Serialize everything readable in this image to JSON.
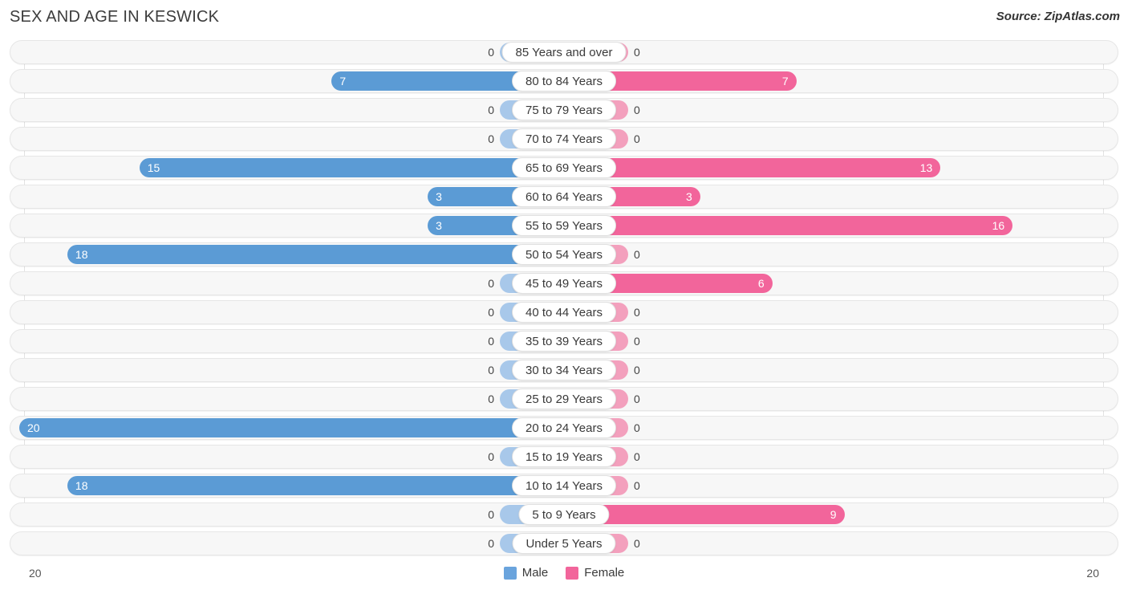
{
  "header": {
    "title": "SEX AND AGE IN KESWICK",
    "source": "Source: ZipAtlas.com"
  },
  "axis": {
    "left_label": "20",
    "right_label": "20"
  },
  "legend": {
    "items": [
      {
        "label": "Male",
        "color": "#6aa4dd",
        "icon": "male-swatch"
      },
      {
        "label": "Female",
        "color": "#f2659b",
        "icon": "female-swatch"
      }
    ]
  },
  "colors": {
    "male_strong": "#5b9bd5",
    "male_light": "#a8c8ea",
    "female_strong": "#f2659b",
    "female_light": "#f3a0bd",
    "row_bg": "#f7f7f7",
    "row_border": "#e6e6e6",
    "gridline": "#e2e2e2"
  },
  "chart_data": {
    "type": "bar",
    "subtype": "population-pyramid",
    "title": "SEX AND AGE IN KESWICK",
    "xlabel": "",
    "ylabel": "",
    "xlim": [
      20,
      20
    ],
    "grid": true,
    "legend_position": "bottom-center",
    "categories": [
      "85 Years and over",
      "80 to 84 Years",
      "75 to 79 Years",
      "70 to 74 Years",
      "65 to 69 Years",
      "60 to 64 Years",
      "55 to 59 Years",
      "50 to 54 Years",
      "45 to 49 Years",
      "40 to 44 Years",
      "35 to 39 Years",
      "30 to 34 Years",
      "25 to 29 Years",
      "20 to 24 Years",
      "15 to 19 Years",
      "10 to 14 Years",
      "5 to 9 Years",
      "Under 5 Years"
    ],
    "series": [
      {
        "name": "Male",
        "values": [
          0,
          7,
          0,
          0,
          15,
          3,
          3,
          18,
          0,
          0,
          0,
          0,
          0,
          20,
          0,
          18,
          0,
          0
        ]
      },
      {
        "name": "Female",
        "values": [
          0,
          7,
          0,
          0,
          13,
          3,
          16,
          0,
          6,
          0,
          0,
          0,
          0,
          0,
          0,
          0,
          9,
          0
        ]
      }
    ]
  }
}
